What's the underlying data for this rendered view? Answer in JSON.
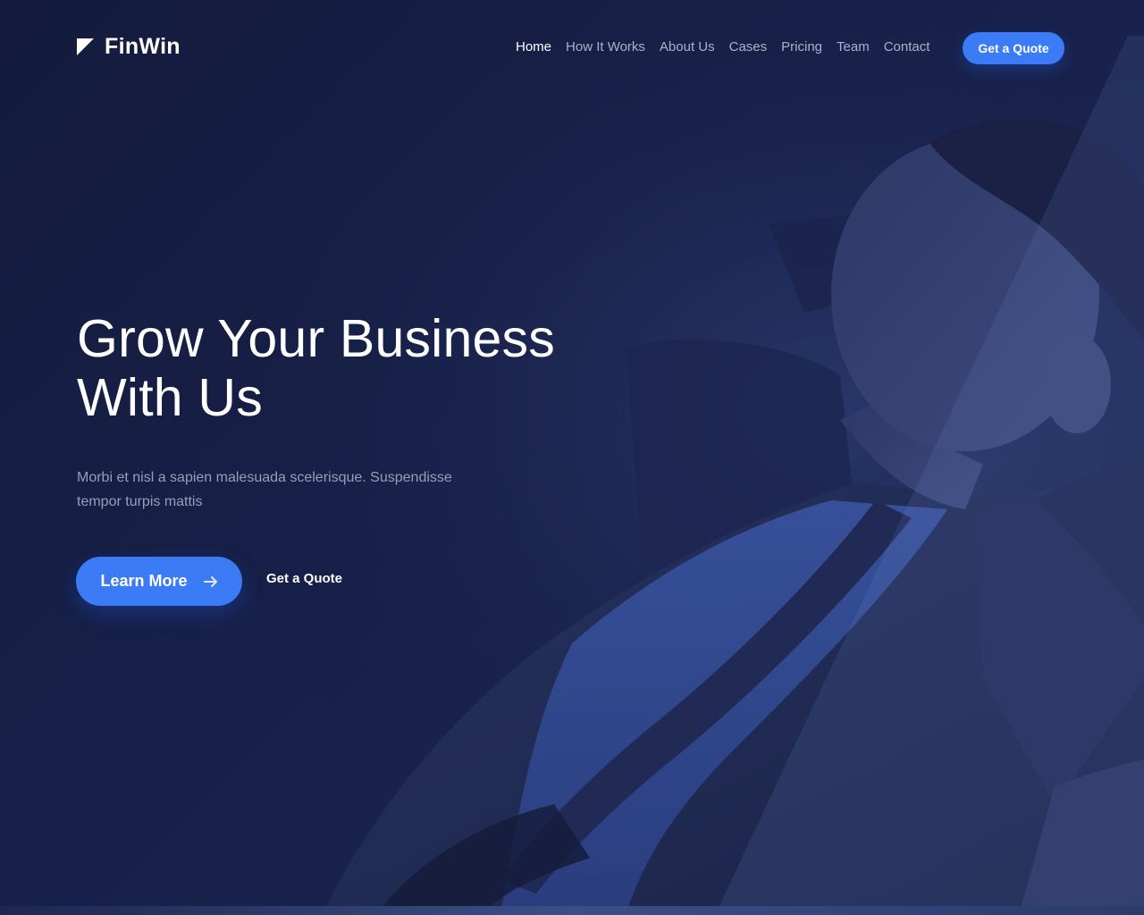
{
  "brand": {
    "name": "FinWin",
    "logo_icon": "triangle-logo-icon"
  },
  "nav": {
    "items": [
      {
        "label": "Home",
        "active": true
      },
      {
        "label": "How It Works",
        "active": false
      },
      {
        "label": "About Us",
        "active": false
      },
      {
        "label": "Cases",
        "active": false
      },
      {
        "label": "Pricing",
        "active": false
      },
      {
        "label": "Team",
        "active": false
      },
      {
        "label": "Contact",
        "active": false
      }
    ],
    "cta_label": "Get a Quote"
  },
  "hero": {
    "title_line1": "Grow Your Business",
    "title_line2": "With Us",
    "subtitle": "Morbi et nisl a sapien malesuada scelerisque. Suspendisse tempor turpis mattis",
    "primary_label": "Learn More",
    "primary_icon": "arrow-right-icon",
    "secondary_label": "Get a Quote"
  },
  "colors": {
    "background": "#151c3f",
    "accent": "#3b7cf6",
    "text_primary": "#ffffff",
    "text_muted": "#979eb8",
    "nav_muted": "#aab1c9"
  }
}
